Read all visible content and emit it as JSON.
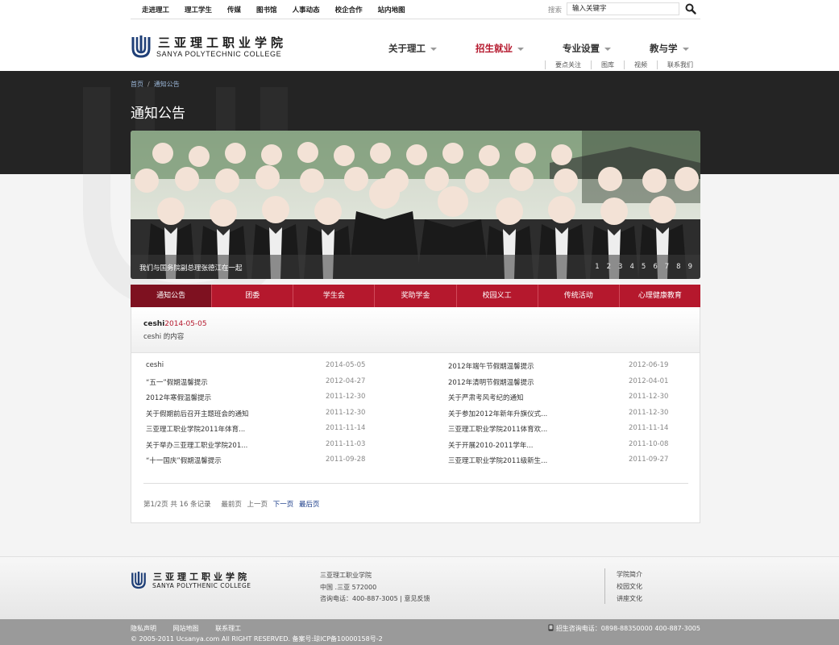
{
  "topbar": {
    "links": [
      "走进理工",
      "理工学生",
      "传媒",
      "图书馆",
      "人事动态",
      "校企合作",
      "站内地图"
    ],
    "search_label": "搜索",
    "search_placeholder": "输入关键字"
  },
  "logo": {
    "cn": "三亚理工职业学院",
    "en": "SANYA POLYTECHNIC COLLEGE"
  },
  "nav": {
    "items": [
      "关于理工",
      "招生就业",
      "专业设置",
      "教与学"
    ],
    "active_index": 1,
    "sub_items": [
      "要点关注",
      "图库",
      "视频",
      "联系我们"
    ]
  },
  "breadcrumb": {
    "home": "首页",
    "separator": "/",
    "current": "通知公告"
  },
  "page_title": "通知公告",
  "slider": {
    "caption": "我们与国务院副总理张德江在一起",
    "pages": [
      "1",
      "2",
      "3",
      "4",
      "5",
      "6",
      "7",
      "8",
      "9"
    ]
  },
  "tabs": [
    "通知公告",
    "团委",
    "学生会",
    "奖助学金",
    "校园义工",
    "传统活动",
    "心理健康教育"
  ],
  "featured": {
    "title": "ceshi",
    "date": "2014-05-05",
    "body": "ceshi 的内容"
  },
  "news_left": [
    {
      "title": "ceshi",
      "date": "2014-05-05"
    },
    {
      "title": "“五一”假期温馨提示",
      "date": "2012-04-27"
    },
    {
      "title": "2012年寒假温馨提示",
      "date": "2011-12-30"
    },
    {
      "title": "关于假期前后召开主题班会的通知",
      "date": "2011-12-30"
    },
    {
      "title": "三亚理工职业学院2011年体育...",
      "date": "2011-11-14"
    },
    {
      "title": "关于举办三亚理工职业学院201...",
      "date": "2011-11-03"
    },
    {
      "title": "“十一国庆”假期温馨提示",
      "date": "2011-09-28"
    }
  ],
  "news_right": [
    {
      "title": "2012年端午节假期温馨提示",
      "date": "2012-06-19"
    },
    {
      "title": "2012年清明节假期温馨提示",
      "date": "2012-04-01"
    },
    {
      "title": "关于严肃考风考纪的通知",
      "date": "2011-12-30"
    },
    {
      "title": "关于参加2012年新年升旗仪式...",
      "date": "2011-12-30"
    },
    {
      "title": "三亚理工职业学院2011体育欢...",
      "date": "2011-11-14"
    },
    {
      "title": "关于开展2010-2011学年...",
      "date": "2011-10-08"
    },
    {
      "title": "三亚理工职业学院2011级新生...",
      "date": "2011-09-27"
    }
  ],
  "pagination": {
    "summary": "第1/2页 共 16 条记录",
    "first": "最前页",
    "prev": "上一页",
    "next": "下一页",
    "last": "最后页"
  },
  "footer": {
    "logo_cn": "三亚理工职业学院",
    "logo_en": "SANYA POLYTHENIC COLLEGE",
    "info_name": "三亚理工职业学院",
    "info_address": "中国 .三亚 572000",
    "info_phone": "咨询电话：400-887-3005",
    "info_feedback": "意见反馈",
    "links": [
      "学院简介",
      "校园文化",
      "讲座文化"
    ]
  },
  "bottombar": {
    "links": [
      "隐私声明",
      "网站地图",
      "联系理工"
    ],
    "copyright": "© 2005-2011 Ucsanya.com All RIGHT RESERVED.  备案号:琼ICP备10000158号-2",
    "phone": "招生咨询电话：0898-88350000 400-887-3005"
  },
  "colors": {
    "brand_red": "#b5182d",
    "dark_band": "#242424",
    "link_blue": "#1c3e8a"
  }
}
